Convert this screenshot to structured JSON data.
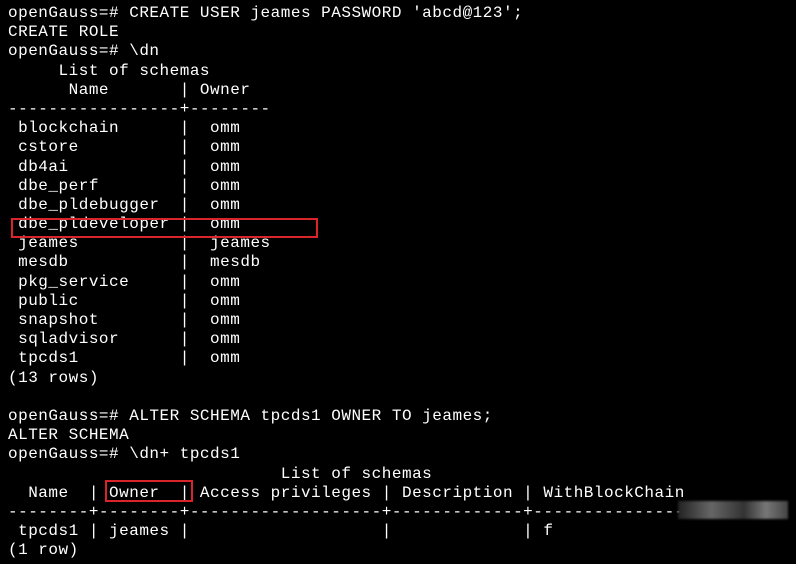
{
  "l0": "openGauss=# CREATE USER jeames PASSWORD 'abcd@123';",
  "l1": "CREATE ROLE",
  "l2": "openGauss=# \\dn",
  "l3": "     List of schemas",
  "l4": "      Name       | Owner  ",
  "l5": "-----------------+--------",
  "r0_n": " blockchain",
  "r0_o": "omm",
  "r1_n": " cstore",
  "r1_o": "omm",
  "r2_n": " db4ai",
  "r2_o": "omm",
  "r3_n": " dbe_perf",
  "r3_o": "omm",
  "r4_n": " dbe_pldebugger",
  "r4_o": "omm",
  "r5_n": " dbe_pldeveloper",
  "r5_o": "omm",
  "r6_n": " jeames",
  "r6_o": "jeames",
  "r7_n": " mesdb",
  "r7_o": "mesdb",
  "r8_n": " pkg_service",
  "r8_o": "omm",
  "r9_n": " public",
  "r9_o": "omm",
  "r10_n": " snapshot",
  "r10_o": "omm",
  "r11_n": " sqladvisor",
  "r11_o": "omm",
  "r12_n": " tpcds1",
  "r12_o": "omm",
  "l6": "(13 rows)",
  "blank": " ",
  "l7": "openGauss=# ALTER SCHEMA tpcds1 OWNER TO jeames;",
  "l8": "ALTER SCHEMA",
  "l9": "openGauss=# \\dn+ tpcds1",
  "l10": "                           List of schemas",
  "l11": "  Name  | Owner  | Access privileges | Description | WithBlockChain ",
  "l12": "--------+--------+-------------------+-------------+----------------",
  "l13": " tpcds1 | jeames |                   |             | f",
  "l14": "(1 row)"
}
